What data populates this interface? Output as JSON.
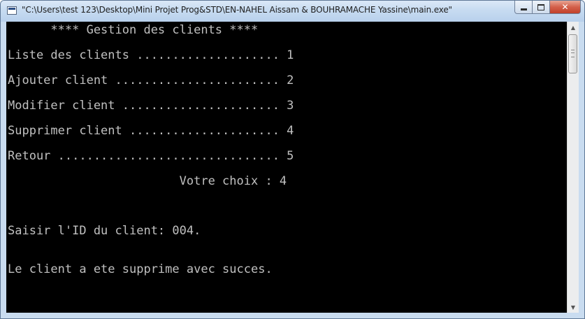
{
  "window": {
    "title": "\"C:\\Users\\test 123\\Desktop\\Mini Projet Prog&STD\\EN-NAHEL Aissam & BOUHRAMACHE Yassine\\main.exe\"",
    "close_glyph": "✕",
    "up_arrow": "▲",
    "down_arrow": "▼"
  },
  "console": {
    "lines": [
      "      **** Gestion des clients ****",
      "Liste des clients .................... 1",
      "Ajouter client ....................... 2",
      "Modifier client ...................... 3",
      "Supprimer client ..................... 4",
      "Retour ............................... 5",
      "                        Votre choix : 4",
      "Saisir l'ID du client: 004.",
      "Le client a ete supprime avec succes."
    ]
  },
  "colors": {
    "console_bg": "#000000",
    "console_text": "#c0c0c0",
    "titlebar": "#c7dbf1",
    "close_button": "#c84a34"
  }
}
